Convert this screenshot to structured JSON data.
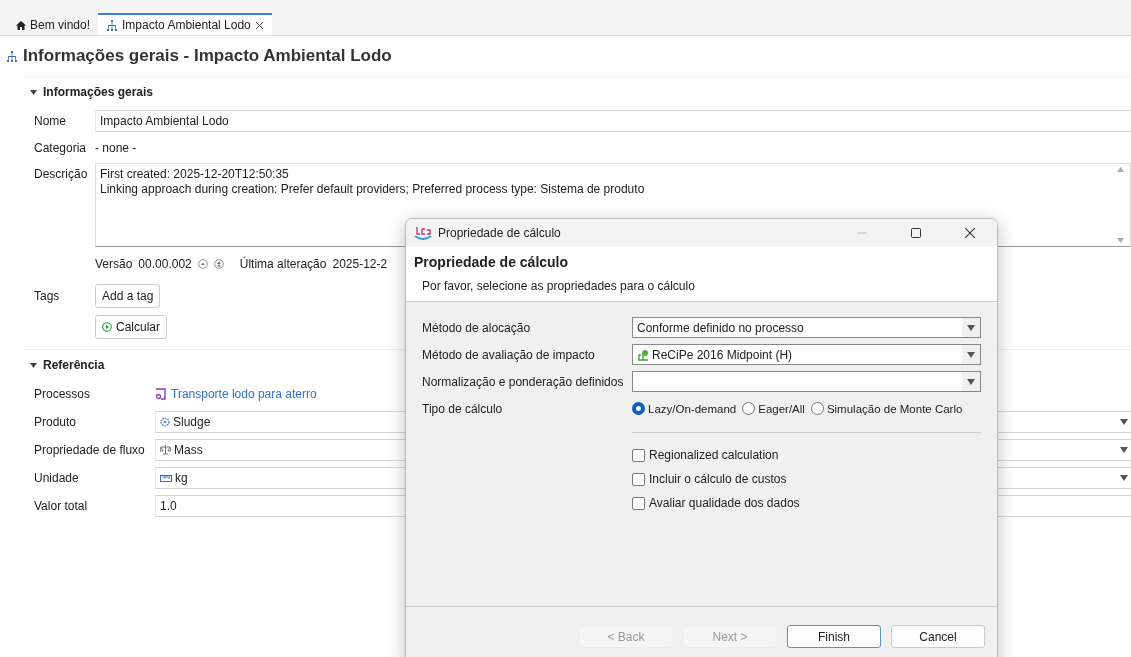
{
  "tabs": [
    {
      "label": "Bem vindo!",
      "kind": "home",
      "selected": false,
      "closable": false
    },
    {
      "label": "Impacto Ambiental Lodo",
      "kind": "system",
      "selected": true,
      "closable": true
    }
  ],
  "page_title": "Informações gerais - Impacto Ambiental Lodo",
  "general": {
    "header": "Informações gerais",
    "expanded": true,
    "name": {
      "label": "Nome",
      "value": "Impacto Ambiental Lodo"
    },
    "category": {
      "label": "Categoria",
      "value": "- none -"
    },
    "description": {
      "label": "Descrição",
      "lines": [
        "First created: 2025-12-20T12:50:35",
        "Linking approach during creation: Prefer default providers; Preferred process type: Sistema de produto"
      ]
    },
    "version": {
      "label": "Versão",
      "value": "00.00.002"
    },
    "last_change": {
      "label": "Última alteração",
      "value": "2025-12-2"
    },
    "tags": {
      "label": "Tags",
      "button": "Add a tag"
    },
    "calculate_button": "Calcular"
  },
  "reference": {
    "header": "Referência",
    "expanded": true,
    "rows": [
      {
        "kind": "link",
        "label": "Processos",
        "value": "Transporte lodo para aterro"
      },
      {
        "kind": "flow",
        "label": "Produto",
        "value": "Sludge"
      },
      {
        "kind": "property",
        "label": "Propriedade de fluxo",
        "value": "Mass"
      },
      {
        "kind": "unit",
        "label": "Unidade",
        "value": "kg"
      },
      {
        "kind": "text",
        "label": "Valor total",
        "value": "1.0"
      }
    ]
  },
  "dialog": {
    "title": "Propriedade de cálculo",
    "heading": "Propriedade de cálculo",
    "subtitle": "Por favor, selecione as propriedades para o cálculo",
    "fields": [
      {
        "kind": "plain",
        "label": "Método de alocação",
        "value": "Conforme definido no processo"
      },
      {
        "kind": "method",
        "label": "Método de avaliação de impacto",
        "value": "ReCiPe 2016 Midpoint (H)"
      },
      {
        "kind": "plain",
        "label": "Normalização e ponderação definidos"
      }
    ],
    "calc_type": {
      "label": "Tipo de cálculo",
      "options": [
        {
          "label": "Lazy/On-demand",
          "selected": true
        },
        {
          "label": "Eager/All",
          "selected": false
        },
        {
          "label": "Simulação de Monte Carlo",
          "selected": false
        }
      ]
    },
    "options": [
      {
        "label": "Regionalized calculation",
        "checked": false
      },
      {
        "label": "Incluir o cálculo de custos",
        "checked": false
      },
      {
        "label": "Avaliar qualidade dos dados",
        "checked": false
      }
    ],
    "buttons": [
      {
        "label": "< Back",
        "disabled": true,
        "default": false
      },
      {
        "label": "Next >",
        "disabled": true,
        "default": false
      },
      {
        "label": "Finish",
        "disabled": false,
        "default": true
      },
      {
        "label": "Cancel",
        "disabled": false,
        "default": false
      }
    ]
  }
}
